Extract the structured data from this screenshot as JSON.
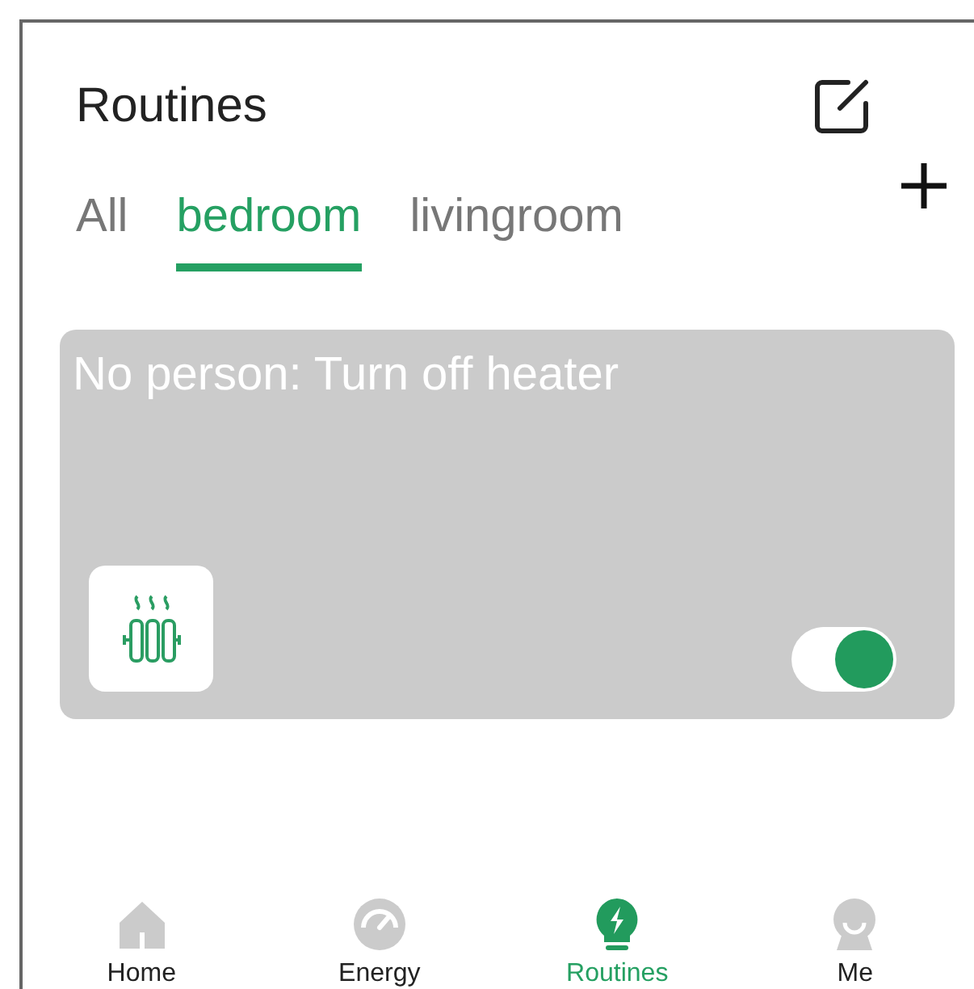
{
  "header": {
    "title": "Routines"
  },
  "tabs": [
    {
      "label": "All",
      "selected": false
    },
    {
      "label": "bedroom",
      "selected": true
    },
    {
      "label": "livingroom",
      "selected": false
    }
  ],
  "routines": [
    {
      "name": "No person: Turn off heater",
      "on": true
    }
  ],
  "nav": [
    {
      "label": "Home",
      "kind": "home",
      "selected": false
    },
    {
      "label": "Energy",
      "kind": "energy",
      "selected": false
    },
    {
      "label": "Routines",
      "kind": "routines",
      "selected": true
    },
    {
      "label": "Me",
      "kind": "me",
      "selected": false
    }
  ]
}
